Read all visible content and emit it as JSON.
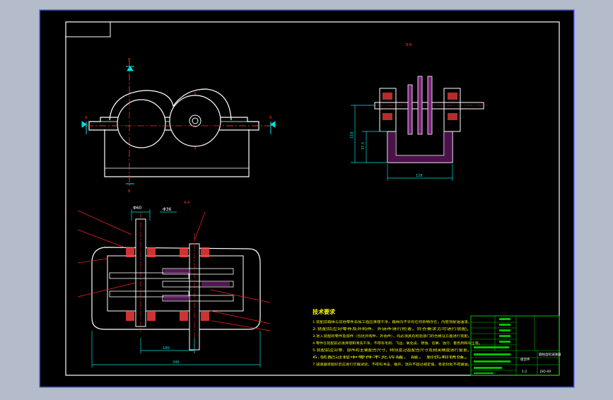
{
  "colors": {
    "outer_bg": "#b4bccb",
    "drawing_bg": "#000000",
    "frame": "#ffffff",
    "outline": "#ffffff",
    "centerline": "#ff3030",
    "dimension": "#00e0e0",
    "hatch": "#d040d0",
    "title_block": "#00c000",
    "notes": "#ffff00",
    "leader": "#ff2020"
  },
  "section_labels": {
    "top_section": "B-B",
    "main_section": "A-A",
    "marker_b": "B",
    "marker_a": "A"
  },
  "dimensions": {
    "d116": "116",
    "d37_5": "37.5",
    "d128": "128",
    "phi60": "Φ60",
    "phi36": "Φ36",
    "d180": "180",
    "d340": "340"
  },
  "tech_notes": {
    "title": "技术要求",
    "lines": [
      "1.装配前箱体与其他零件非加工面应清理干净，箱体内不许有任何杂物存在，内壁涂耐油油漆。",
      "2.装配前应对零件及外购件、外协件进行检查，符合要求方可进行装配。",
      "3.进入装配的零件及部件（包括外购件、外协件），均必须具有检验部门的合格证方能进行装配。",
      "4.零件在装配前必须清理和清洗干净，不得有毛刺、飞边、氧化皮、锈蚀、切屑、油污、着色剂和灰尘等。",
      "5.装配前应对零、部件的主要配合尺寸，特别是过盈配合尺寸及相关精度进行复查。",
      "6.装配过程中零件不允许磕、碰、划伤和锈蚀。",
      "7.减速器装配好后应进行空载试验，不得有冲击、噪声，温升不超过规定值，各密封处不得漏油。"
    ]
  },
  "title_block": {
    "name": "圆柱齿轮减速器",
    "drawing_no": "JSQ-00",
    "material": "组合件",
    "scale": "1:2"
  }
}
